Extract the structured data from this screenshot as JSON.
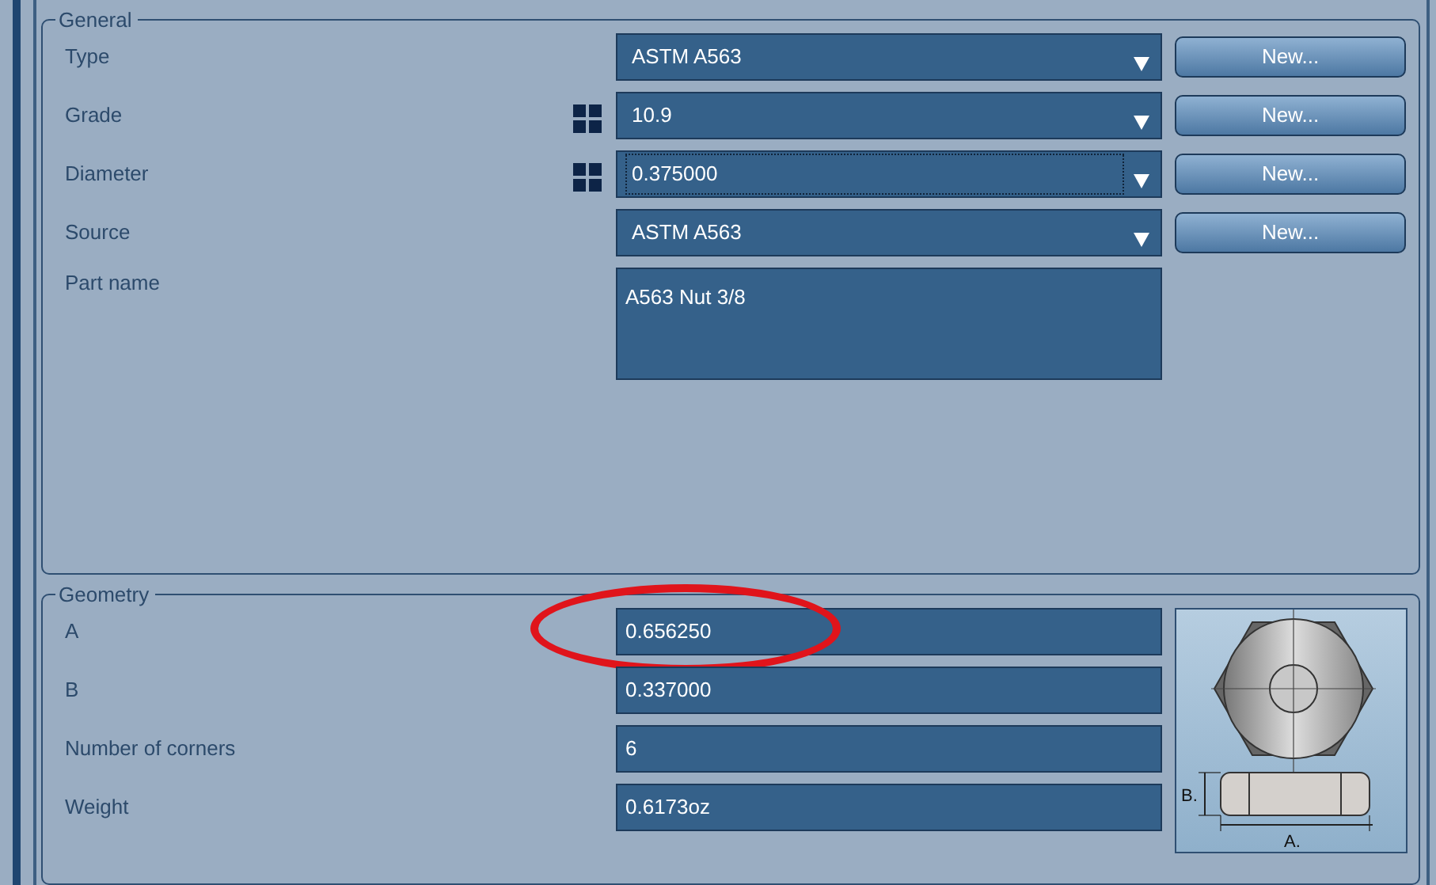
{
  "general": {
    "title": "General",
    "rows": [
      {
        "label": "Type",
        "kind": "combo",
        "value": "ASTM A563",
        "grid_icon": false,
        "focused": false,
        "button": "New..."
      },
      {
        "label": "Grade",
        "kind": "combo",
        "value": "10.9",
        "grid_icon": true,
        "focused": false,
        "button": "New..."
      },
      {
        "label": "Diameter",
        "kind": "combo",
        "value": "0.375000",
        "grid_icon": true,
        "focused": true,
        "button": "New..."
      },
      {
        "label": "Source",
        "kind": "combo",
        "value": "ASTM A563",
        "grid_icon": false,
        "focused": false,
        "button": "New..."
      },
      {
        "label": "Part name",
        "kind": "textarea",
        "value": "A563 Nut 3/8"
      }
    ]
  },
  "geometry": {
    "title": "Geometry",
    "rows": [
      {
        "label": "A",
        "value": "0.656250",
        "highlighted": true
      },
      {
        "label": "B",
        "value": "0.337000",
        "highlighted": false
      },
      {
        "label": "Number of corners",
        "value": "6",
        "highlighted": false
      },
      {
        "label": "Weight",
        "value": "0.6173oz",
        "highlighted": false
      }
    ],
    "figure": {
      "height_label": "B.",
      "width_label": "A."
    }
  }
}
